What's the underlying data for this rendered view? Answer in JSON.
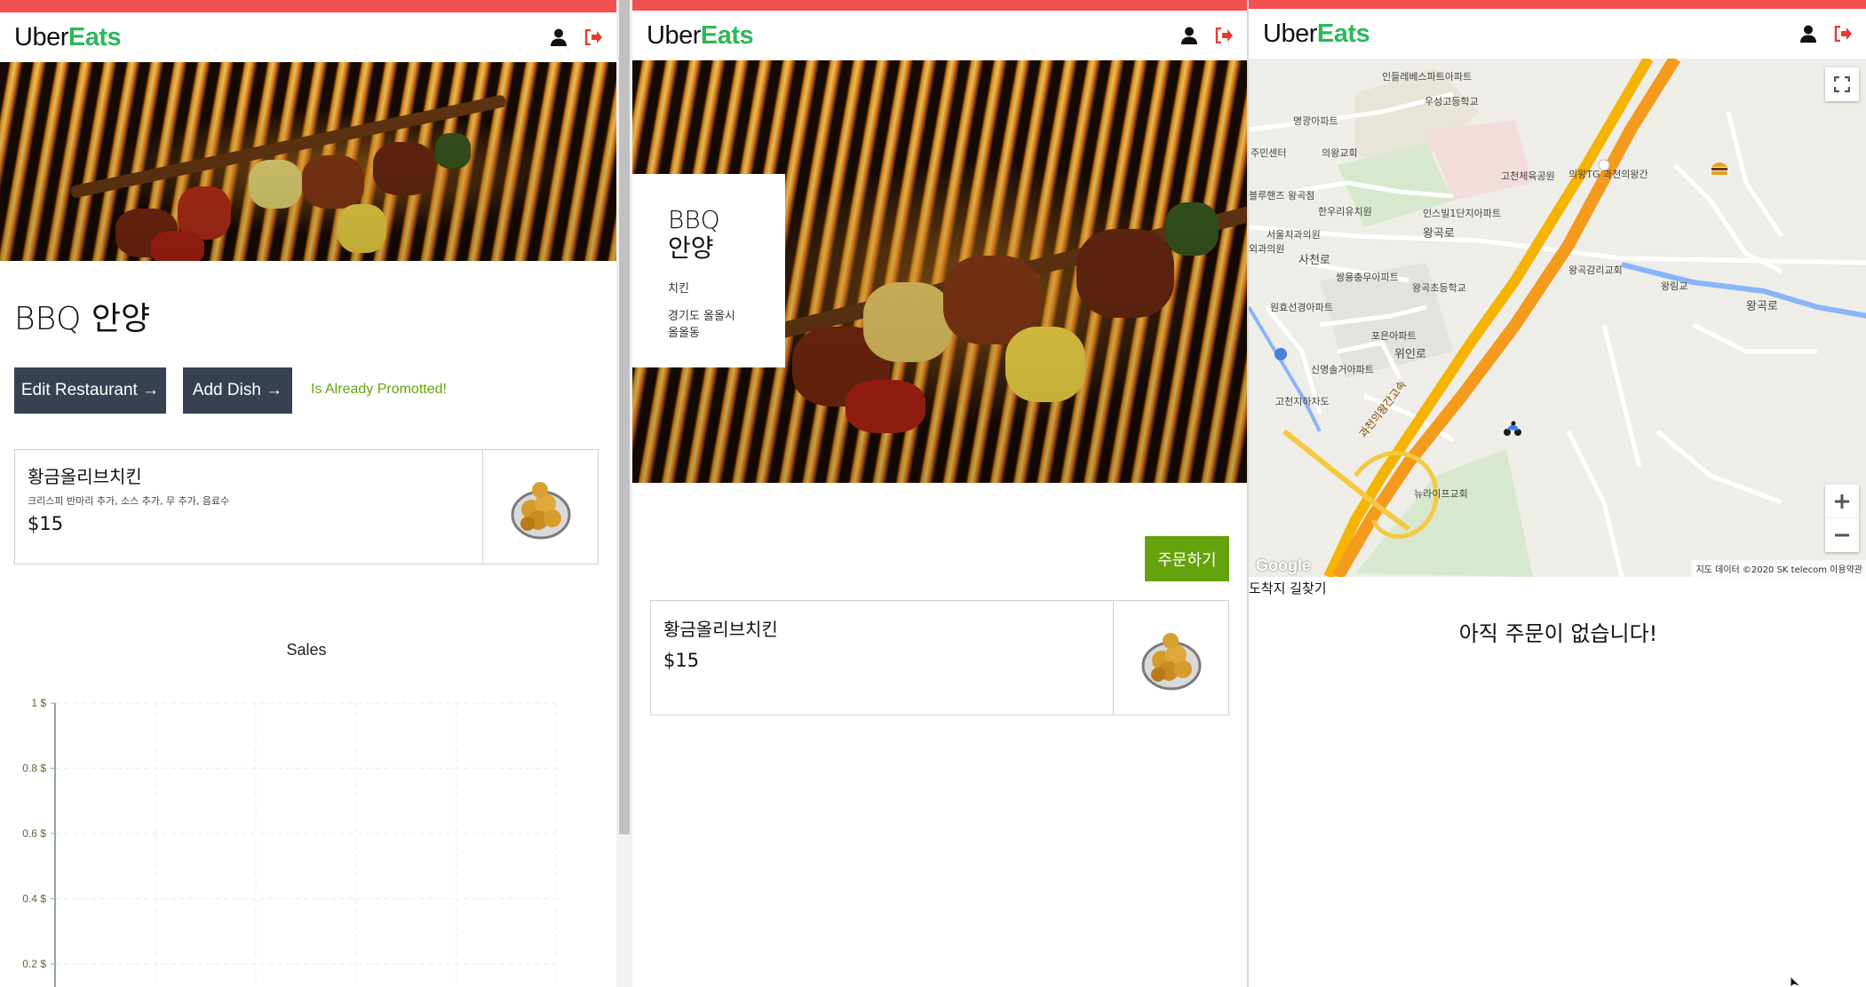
{
  "brand": {
    "uber": "Uber",
    "eats": "Eats"
  },
  "colors": {
    "topbar": "#f15151",
    "logo_green": "#2db85a",
    "dark_button": "#374151",
    "lime": "#65a30d",
    "logout_red": "#e53935"
  },
  "owner": {
    "restaurant_name": "BBQ 안양",
    "edit_button": "Edit Restaurant →",
    "add_dish_button": "Add Dish →",
    "promoted_text": "Is Already Promotted!",
    "dish": {
      "name": "황금올리브치킨",
      "options": "크리스피 반마리 추가, 소스 추가, 무 추가, 음료수",
      "price": "$15"
    },
    "chart_title": "Sales"
  },
  "customer": {
    "name_line1": "BBQ",
    "name_line2": "안양",
    "category": "치킨",
    "address_line1": "경기도 올올시",
    "address_line2": "올올동",
    "order_button": "주문하기",
    "dish": {
      "name": "황금올리브치킨",
      "price": "$15"
    }
  },
  "driver": {
    "map_labels": {
      "apt1": "인들레베스파트아파트",
      "school1": "우성고등학교",
      "apt2": "명광아파트",
      "center": "주민센터",
      "church1": "의왕교회",
      "park": "고천체육공원",
      "station": "의왕TG 과천의왕간",
      "building1": "블루핸즈 왕곡점",
      "kinder": "한우리유치원",
      "apt3": "인스빌1단지아파트",
      "road1": "왕곡로",
      "dental": "서울치과의원",
      "clinic": "외과의원",
      "road2": "사천로",
      "apt4": "쌍용충무아파트",
      "school2": "왕곡초등학교",
      "church2": "왕곡감리교회",
      "bridge": "왕림교",
      "road3": "왕곡로",
      "apt5": "원효선경아파트",
      "apt6": "포은아파트",
      "road4": "위인로",
      "apt7": "신명솔거아파트",
      "garage": "고천지하차도",
      "highway": "과천의왕간고속",
      "church3": "뉴라이프교회"
    },
    "google": "Google",
    "attribution": "지도 데이터 ©2020 SK telecom   이용약관",
    "directions_label": "도착지 길찾기",
    "no_orders_text": "아직 주문이 없습니다!"
  },
  "chart_data": {
    "type": "line",
    "title": "Sales",
    "xlabel": "",
    "ylabel": "",
    "y_ticks": [
      "1 $",
      "0.8 $",
      "0.6 $",
      "0.4 $",
      "0.2 $"
    ],
    "ylim": [
      0,
      1
    ],
    "grid": true,
    "series": []
  }
}
